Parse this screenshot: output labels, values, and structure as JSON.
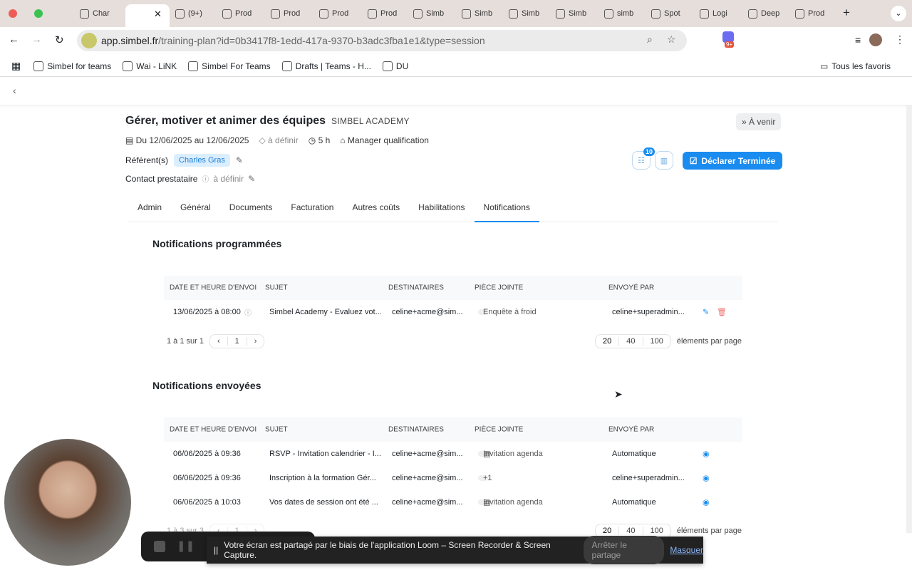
{
  "browser": {
    "tabs": [
      "Char",
      "",
      "(9+)",
      "Prod",
      "Prod",
      "Prod",
      "Prod",
      "Simb",
      "Simb",
      "Simb",
      "Simb",
      "simb",
      "Spot",
      "Logi",
      "Deep",
      "Prod"
    ],
    "url_host": "app.simbel.fr",
    "url_path": "/training-plan?id=0b3417f8-1edd-417a-9370-b3adc3fba1e1&type=session",
    "extension_badge": "9+",
    "bookmarks": [
      "Simbel for teams",
      "Wai - LiNK",
      "Simbel For Teams",
      "Drafts | Teams - H...",
      "DU"
    ],
    "all_bookmarks": "Tous les favoris"
  },
  "session": {
    "title": "Gérer, motiver et animer des équipes",
    "org": "SIMBEL ACADEMY",
    "status": "À venir",
    "dates": "Du 12/06/2025 au 12/06/2025",
    "location": "à définir",
    "duration": "5 h",
    "qualification": "Manager qualification",
    "referents_label": "Référent(s)",
    "referent": "Charles Gras",
    "contact_label": "Contact prestataire",
    "contact": "à définir",
    "badge_count": "10",
    "declare_button": "Déclarer Terminée"
  },
  "tabs": [
    "Admin",
    "Général",
    "Documents",
    "Facturation",
    "Autres coûts",
    "Habilitations",
    "Notifications"
  ],
  "active_tab": "Notifications",
  "columns": [
    "DATE ET HEURE D'ENVOI",
    "SUJET",
    "DESTINATAIRES",
    "PIÈCE JOINTE",
    "ENVOYÉ PAR"
  ],
  "scheduled": {
    "title": "Notifications programmées",
    "rows": [
      {
        "date": "13/06/2025 à 08:00",
        "subject": "Simbel Academy - Evaluez vot...",
        "to": "celine+acme@sim...",
        "attachment": "Enquête à froid",
        "by": "celine+superadmin..."
      }
    ],
    "range": "1 à 1 sur 1",
    "page": "1"
  },
  "sent": {
    "title": "Notifications envoyées",
    "rows": [
      {
        "date": "06/06/2025 à 09:36",
        "subject": "RSVP - Invitation calendrier - I...",
        "to": "celine+acme@sim...",
        "attachment": "Invitation agenda",
        "by": "Automatique"
      },
      {
        "date": "06/06/2025 à 09:36",
        "subject": "Inscription à la formation Gér...",
        "to": "celine+acme@sim...",
        "attachment": "+1",
        "by": "celine+superadmin..."
      },
      {
        "date": "06/06/2025 à 10:03",
        "subject": "Vos dates de session ont été ...",
        "to": "celine+acme@sim...",
        "attachment": "Invitation agenda",
        "by": "Automatique"
      }
    ],
    "range": "1 à 3 sur 3",
    "page": "1"
  },
  "page_sizes": [
    "20",
    "40",
    "100"
  ],
  "per_page_label": "éléments par page",
  "share_bar": {
    "message": "Votre écran est partagé par le biais de l'application Loom – Screen Recorder & Screen Capture.",
    "stop": "Arrêter le partage",
    "hide": "Masquer"
  },
  "colors": {
    "accent": "#1a8cf0",
    "delete": "#f07070"
  }
}
